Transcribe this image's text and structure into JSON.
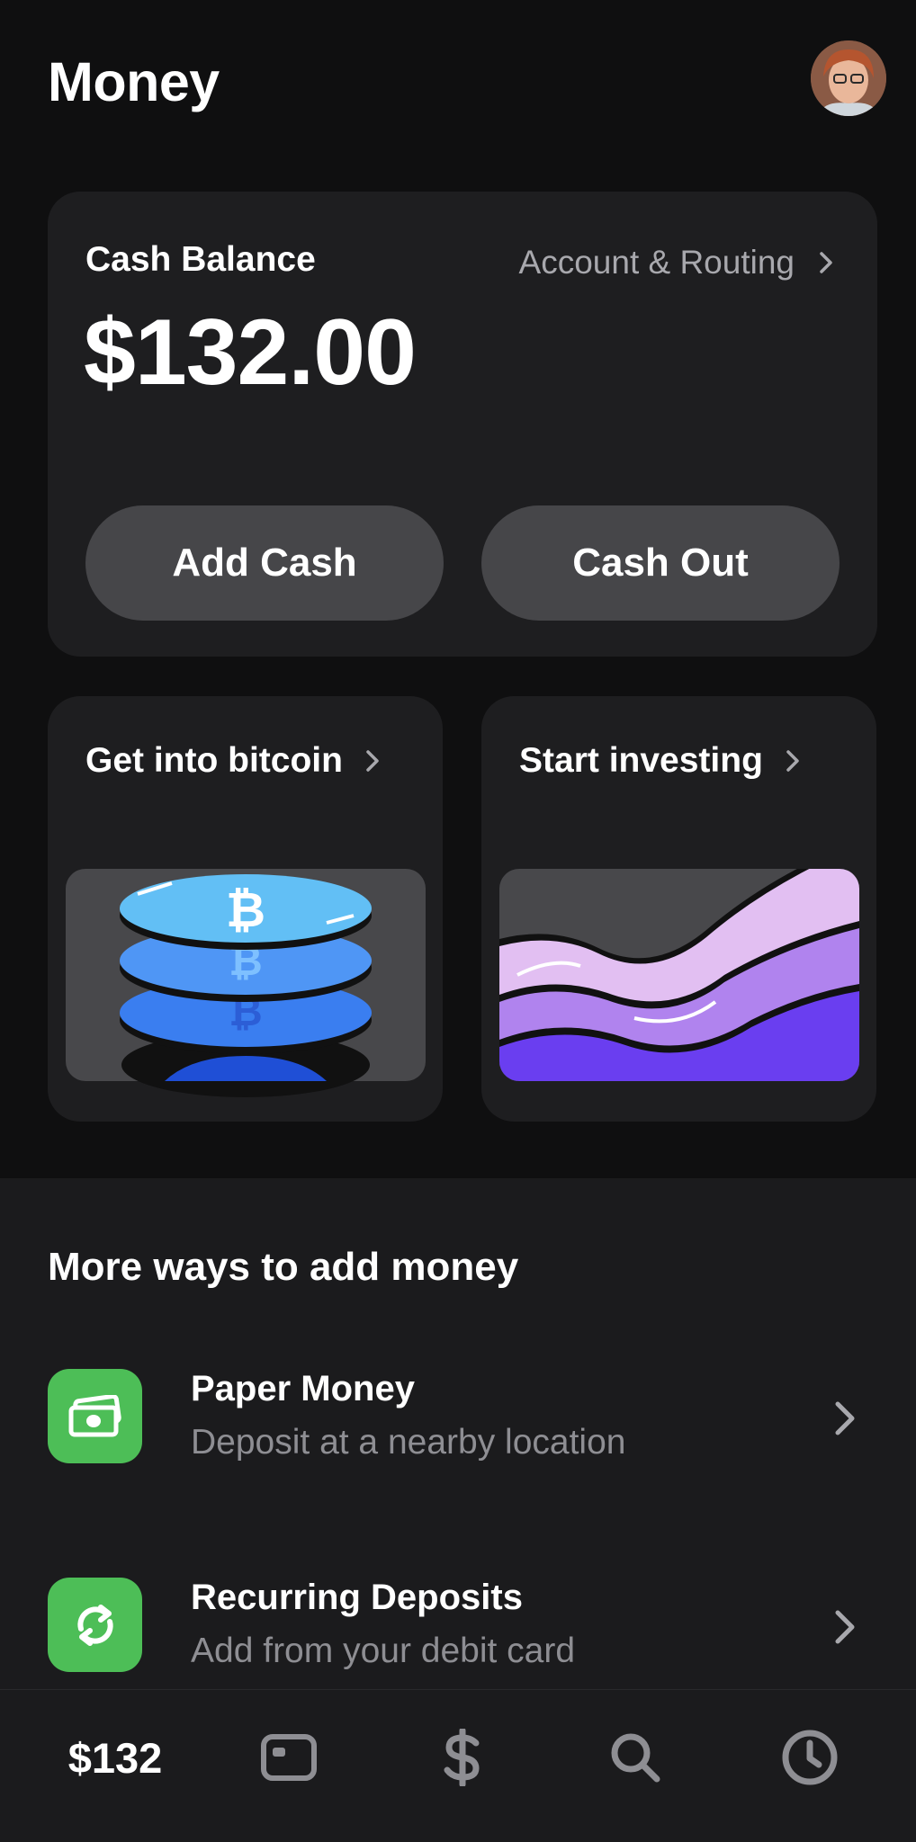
{
  "header": {
    "title": "Money"
  },
  "balance_card": {
    "label": "Cash Balance",
    "account_link": "Account & Routing",
    "amount": "$132.00",
    "add_cash": "Add Cash",
    "cash_out": "Cash Out"
  },
  "promos": [
    {
      "title": "Get into bitcoin"
    },
    {
      "title": "Start investing"
    }
  ],
  "more_ways": {
    "title": "More ways to add money",
    "items": [
      {
        "title": "Paper Money",
        "subtitle": "Deposit at a nearby location",
        "icon": "cash-icon"
      },
      {
        "title": "Recurring Deposits",
        "subtitle": "Add from your debit card",
        "icon": "recurring-icon"
      }
    ]
  },
  "tabbar": {
    "balance_label": "$132",
    "icons": [
      "card-icon",
      "dollar-icon",
      "search-icon",
      "clock-icon"
    ]
  },
  "colors": {
    "accent_green": "#4dbe57",
    "bitcoin_blue": "#3d8bf5",
    "invest_purple": "#6a3ef0"
  }
}
